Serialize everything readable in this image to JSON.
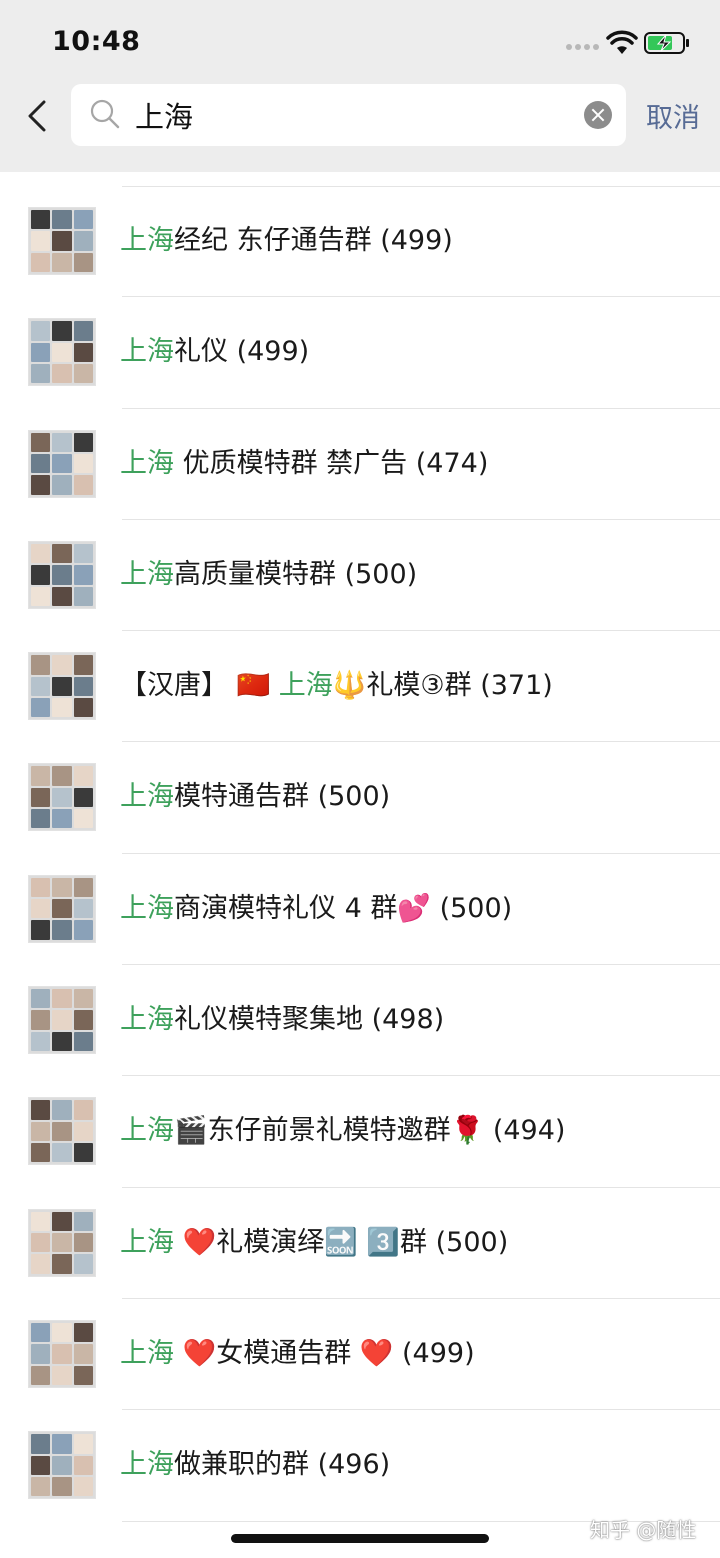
{
  "status_bar": {
    "time": "10:48"
  },
  "search": {
    "query": "上海",
    "cancel_label": "取消"
  },
  "groups": [
    {
      "highlight": "上海",
      "rest": "经纪 东仔通告群",
      "count": "(499)"
    },
    {
      "highlight": "上海",
      "rest": "礼仪",
      "count": "(499)"
    },
    {
      "highlight": "上海",
      "rest": " 优质模特群 禁广告",
      "count": "(474)"
    },
    {
      "highlight": "上海",
      "rest": "高质量模特群",
      "count": "(500)"
    },
    {
      "prefix": "【汉唐】 🇨🇳 ",
      "highlight": "上海",
      "rest": "🔱礼模③群",
      "count": "(371)"
    },
    {
      "highlight": "上海",
      "rest": "模特通告群",
      "count": "(500)"
    },
    {
      "highlight": "上海",
      "rest": "商演模特礼仪 4 群💕",
      "count": "(500)"
    },
    {
      "highlight": "上海",
      "rest": "礼仪模特聚集地",
      "count": "(498)"
    },
    {
      "highlight": "上海",
      "rest": "🎬东仔前景礼模特邀群🌹",
      "count": "(494)"
    },
    {
      "highlight": "上海",
      "rest": " ❤️礼模演绎🔜 3️⃣群",
      "count": "(500)"
    },
    {
      "highlight": "上海",
      "rest": " ❤️女模通告群 ❤️",
      "count": "(499)"
    },
    {
      "highlight": "上海",
      "rest": "做兼职的群",
      "count": "(496)"
    }
  ],
  "watermark": "知乎 @随性",
  "colors": {
    "highlight": "#3ea15c",
    "cancel": "#576b95",
    "header_bg": "#ededed"
  }
}
